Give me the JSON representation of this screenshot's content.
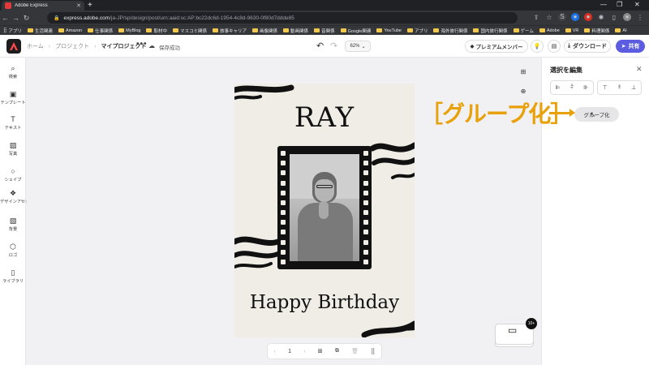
{
  "browser": {
    "tab_title": "Adobe Express",
    "url_host": "express.adobe.com",
    "url_path": "/ja-JP/sp/design/post/urn:aaid:sc:AP:bc22dc6d-1954-4c8d-9630-0f80d7ddde85",
    "bookmarks": [
      "アプリ",
      "生活関連",
      "Amazon",
      "仕事関係",
      "MyBlog",
      "取材中",
      "マスコミ関係",
      "旅事キャリア",
      "画像関係",
      "動画関係",
      "音関係",
      "Google関連",
      "YouTube",
      "アプリ",
      "海外旅行関係",
      "国内旅行関係",
      "ゲーム",
      "Adobe",
      "VR",
      "料理関係",
      "AI"
    ]
  },
  "header": {
    "breadcrumb": [
      "ホーム",
      "プロジェクト",
      "マイプロジェクト"
    ],
    "more": "•••",
    "save_status": "保存成功",
    "zoom": "62%",
    "premium_label": "プレミアムメンバー",
    "download_label": "ダウンロード",
    "share_label": "共有"
  },
  "sidebar": {
    "items": [
      {
        "label": "検索",
        "icon": "search-icon"
      },
      {
        "label": "テンプレート",
        "icon": "template-icon"
      },
      {
        "label": "テキスト",
        "icon": "text-icon"
      },
      {
        "label": "写真",
        "icon": "photo-icon"
      },
      {
        "label": "シェイプ",
        "icon": "shape-icon"
      },
      {
        "label": "デザインアセット",
        "icon": "design-assets-icon"
      },
      {
        "label": "背景",
        "icon": "background-icon"
      },
      {
        "label": "ロゴ",
        "icon": "logo-icon"
      },
      {
        "label": "ライブラリ",
        "icon": "library-icon"
      }
    ]
  },
  "card": {
    "title": "RAY",
    "message": "Happy Birthday"
  },
  "pager": {
    "page": "1"
  },
  "pages_badge": "10+",
  "annotation": "［グループ化］",
  "panel": {
    "title": "選択を編集",
    "group_button": "グループ化"
  },
  "colors": {
    "accent": "#5c5ce0",
    "annotation": "#e8a10a"
  }
}
